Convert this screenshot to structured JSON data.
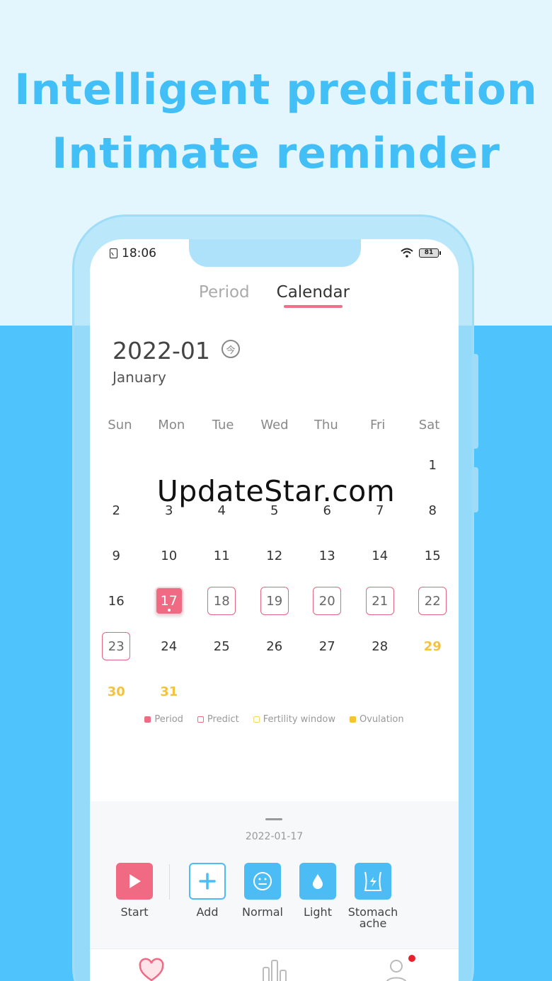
{
  "promo": {
    "line1": "Intelligent prediction",
    "line2": "Intimate reminder"
  },
  "status_bar": {
    "time": "18:06",
    "battery": "81"
  },
  "tabs": [
    {
      "label": "Period",
      "active": false
    },
    {
      "label": "Calendar",
      "active": true
    }
  ],
  "calendar": {
    "month": "2022-01",
    "month_name": "January",
    "today_icon_glyph": "今",
    "weekdays": [
      "Sun",
      "Mon",
      "Tue",
      "Wed",
      "Thu",
      "Fri",
      "Sat"
    ],
    "days": [
      {
        "d": "",
        "t": "empty"
      },
      {
        "d": "",
        "t": "empty"
      },
      {
        "d": "",
        "t": "empty"
      },
      {
        "d": "",
        "t": "empty"
      },
      {
        "d": "",
        "t": "empty"
      },
      {
        "d": "",
        "t": "empty"
      },
      {
        "d": "1",
        "t": "normal"
      },
      {
        "d": "2",
        "t": "normal"
      },
      {
        "d": "3",
        "t": "normal"
      },
      {
        "d": "4",
        "t": "normal"
      },
      {
        "d": "5",
        "t": "normal"
      },
      {
        "d": "6",
        "t": "normal"
      },
      {
        "d": "7",
        "t": "normal"
      },
      {
        "d": "8",
        "t": "normal"
      },
      {
        "d": "9",
        "t": "normal"
      },
      {
        "d": "10",
        "t": "normal"
      },
      {
        "d": "11",
        "t": "normal"
      },
      {
        "d": "12",
        "t": "normal"
      },
      {
        "d": "13",
        "t": "normal"
      },
      {
        "d": "14",
        "t": "normal"
      },
      {
        "d": "15",
        "t": "normal"
      },
      {
        "d": "16",
        "t": "normal"
      },
      {
        "d": "17",
        "t": "period"
      },
      {
        "d": "18",
        "t": "predict"
      },
      {
        "d": "19",
        "t": "predict"
      },
      {
        "d": "20",
        "t": "predict"
      },
      {
        "d": "21",
        "t": "predict"
      },
      {
        "d": "22",
        "t": "predict"
      },
      {
        "d": "23",
        "t": "predict"
      },
      {
        "d": "24",
        "t": "normal"
      },
      {
        "d": "25",
        "t": "normal"
      },
      {
        "d": "26",
        "t": "normal"
      },
      {
        "d": "27",
        "t": "normal"
      },
      {
        "d": "28",
        "t": "normal"
      },
      {
        "d": "29",
        "t": "ovul"
      },
      {
        "d": "30",
        "t": "ovul"
      },
      {
        "d": "31",
        "t": "ovul"
      }
    ]
  },
  "legend": [
    {
      "label": "Period",
      "kind": "period"
    },
    {
      "label": "Predict",
      "kind": "predict"
    },
    {
      "label": "Fertility window",
      "kind": "fertile"
    },
    {
      "label": "Ovulation",
      "kind": "ovul"
    }
  ],
  "sheet": {
    "date": "2022-01-17",
    "start_label": "Start",
    "add_label": "Add",
    "normal_label": "Normal",
    "light_label": "Light",
    "stomach_label": "Stomach ache"
  },
  "watermark": "UpdateStar.com",
  "colors": {
    "accent_pink": "#f16a84",
    "accent_blue": "#4bbdf4",
    "ovulation_yellow": "#f5c33b",
    "headline_blue": "#41bff6"
  }
}
